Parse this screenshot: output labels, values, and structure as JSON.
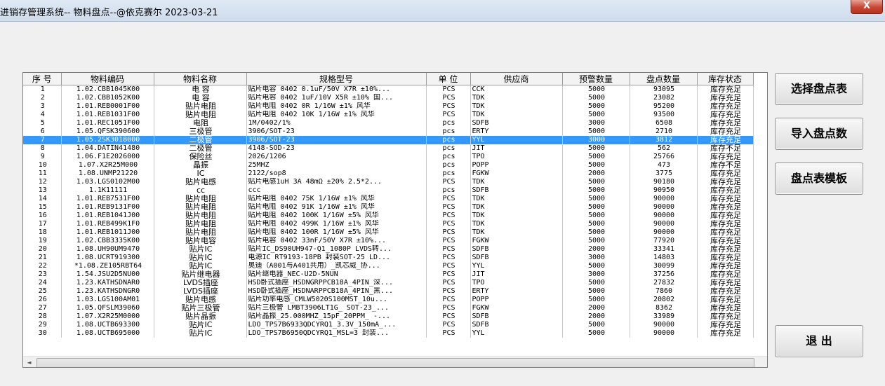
{
  "window": {
    "title": "进销存管理系统-- 物料盘点--@依克赛尔 2023-03-21",
    "close_label": "X"
  },
  "buttons": {
    "select_sheet": "选择盘点表",
    "import_counts": "导入盘点数",
    "template": "盘点表模板",
    "exit": "退 出"
  },
  "grid": {
    "columns": [
      "序 号",
      "物料编码",
      "物料名称",
      "规格型号",
      "单 位",
      "供应商",
      "预警数量",
      "盘点数量",
      "库存状态"
    ],
    "selected_index": 6,
    "rows": [
      [
        "1",
        "1.02.CBB1045K00",
        "电 容",
        "贴片电容 0402 0.1uF/50V X7R ±10%...",
        "PCS",
        "CCK",
        "5000",
        "93095",
        "库存充足"
      ],
      [
        "2",
        "1.02.CBB1052K00",
        "电 容",
        "贴片电容 0402 1uF/10V X5R ±10% 国...",
        "PCS",
        "TDK",
        "5000",
        "23082",
        "库存充足"
      ],
      [
        "3",
        "1.01.REB0001F00",
        "贴片电阻",
        "贴片电阻 0402 0R 1/16W ±1% 风华",
        "PCS",
        "TDK",
        "5000",
        "95200",
        "库存充足"
      ],
      [
        "4",
        "1.01.REB1031F00",
        "贴片电阻",
        "贴片电阻 0402 10K 1/16W ±1% 风华",
        "PCS",
        "TDK",
        "5000",
        "93500",
        "库存充足"
      ],
      [
        "5",
        "1.01.REC1051F00",
        "电阻",
        "1M/0402/1%",
        "pcs",
        "SDFB",
        "3000",
        "6508",
        "库存充足"
      ],
      [
        "6",
        "1.05.QFSK390600",
        "三极管",
        "3906/SOT-23",
        "pcs",
        "ERTY",
        "5000",
        "2710",
        "库存充足"
      ],
      [
        "7",
        "1.05.2SK3018000",
        "二极管",
        "3906/SOT-23",
        "pcs",
        "YYL",
        "3000",
        "3812",
        "库存充足"
      ],
      [
        "8",
        "1.04.DATIN41480",
        "二极管",
        "4148-SOD-23",
        "pcs",
        "JIT",
        "5000",
        "562",
        "库存不足"
      ],
      [
        "9",
        "1.06.F1E2026000",
        "保险丝",
        "2026/1206",
        "pcs",
        "TPO",
        "5000",
        "25766",
        "库存充足"
      ],
      [
        "10",
        "1.07.X2R25M000",
        "晶振",
        "25MHZ",
        "pcs",
        "POPP",
        "5000",
        "473",
        "库存不足"
      ],
      [
        "11",
        "1.08.UNMP21220",
        "IC",
        "2122/sop8",
        "pcs",
        "FGKW",
        "2000",
        "3775",
        "库存充足"
      ],
      [
        "12",
        "1.03.LGS0102M00",
        "贴片电感",
        "贴片电感1uH 3A 48mΩ ±20% 2.5*2...",
        "PCS",
        "TDK",
        "5000",
        "90180",
        "库存充足"
      ],
      [
        "13",
        "1.1K11111",
        "cc",
        "ccc",
        "pcs",
        "SDFB",
        "5000",
        "90950",
        "库存充足"
      ],
      [
        "14",
        "1.01.REB7531F00",
        "贴片电阻",
        "贴片电阻 0402 75K 1/16W ±1% 风华",
        "PCS",
        "TDK",
        "5000",
        "90000",
        "库存充足"
      ],
      [
        "15",
        "1.01.REB9131F00",
        "贴片电阻",
        "贴片电阻 0402 91K 1/16W ±1% 风华",
        "PCS",
        "TDK",
        "5000",
        "90000",
        "库存充足"
      ],
      [
        "16",
        "1.01.REB1041J00",
        "贴片电阻",
        "贴片电阻 0402 100K 1/16W ±5% 风华",
        "PCS",
        "TDK",
        "5000",
        "90000",
        "库存充足"
      ],
      [
        "17",
        "1.01.REB499K1F0",
        "贴片电阻",
        "贴片电阻 0402 499K 1/16W ±1% 风华",
        "PCS",
        "TDK",
        "5000",
        "90000",
        "库存充足"
      ],
      [
        "18",
        "1.01.REB1011J00",
        "贴片电阻",
        "贴片电阻 0402 100R 1/16W ±5% 风华",
        "PCS",
        "TDK",
        "5000",
        "90000",
        "库存充足"
      ],
      [
        "19",
        "1.02.CBB3335K00",
        "贴片电容",
        "贴片电容 0402 33nF/50V X7R ±10%...",
        "PCS",
        "FGKW",
        "5000",
        "77920",
        "库存充足"
      ],
      [
        "20",
        "1.08.UH90UM9470",
        "贴片IC",
        "贴片IC_DS90UH947-Q1_1080P LVDS转...",
        "PCS",
        "SDFB",
        "2000",
        "33341",
        "库存充足"
      ],
      [
        "21",
        "1.08.UCRT919300",
        "贴片IC",
        "电源IC RT9193-18PB 封装SOT-25 LD...",
        "PCS",
        "SDFB",
        "3000",
        "14803",
        "库存充足"
      ],
      [
        "22",
        "*1.08.ZE105RBT64",
        "贴片IC",
        "奥迪（A001与A401共用）_凯芯威_协...",
        "PCS",
        "YYL",
        "5000",
        "30099",
        "库存充足"
      ],
      [
        "23",
        "1.54.JSU2D5NU00",
        "贴片继电器",
        "贴片继电器_NEC-U2D-5NUN",
        "PCS",
        "JIT",
        "3000",
        "37256",
        "库存充足"
      ],
      [
        "24",
        "1.23.KATHSDNAR0",
        "LVDS插座",
        "HSD卧式插座_HSDNGRPPCB18A_4PIN_深...",
        "PCS",
        "TPO",
        "5000",
        "27832",
        "库存充足"
      ],
      [
        "25",
        "1.23.KATHSDNGR0",
        "LVDS插座",
        "HSD卧式插座_HSDNARPPCB18A_4PIN_黑...",
        "PCS",
        "ERTY",
        "5000",
        "7860",
        "库存充足"
      ],
      [
        "26",
        "1.03.LGS100AM01",
        "贴片电感",
        "贴片功率电感_CMLW5020S100MST_10u...",
        "PCS",
        "POPP",
        "5000",
        "20802",
        "库存充足"
      ],
      [
        "27",
        "1.05.QFSLM39060",
        "贴片三极管",
        "贴片三极管 LMBT3906LT1G_ SOT-23_...",
        "PCS",
        "FGKW",
        "2000",
        "8362",
        "库存充足"
      ],
      [
        "28",
        "1.07.X2R25M0000",
        "贴片晶振",
        "贴片晶振_25.000MHZ_15pF_20PPM_ -...",
        "PCS",
        "SDFB",
        "2000",
        "33989",
        "库存充足"
      ],
      [
        "29",
        "1.08.UCTB693300",
        "贴片IC",
        "LDO_TPS7B6933QDCYRQ1_3.3V_150mA_...",
        "PCS",
        "SDFB",
        "5000",
        "90000",
        "库存充足"
      ],
      [
        "30",
        "1.08.UCTB695000",
        "贴片IC",
        "LDO_TPS7B6950QDCYRQ1_MSL=3 封装...",
        "PCS",
        "YYL",
        "5000",
        "90000",
        "库存充足"
      ]
    ]
  }
}
